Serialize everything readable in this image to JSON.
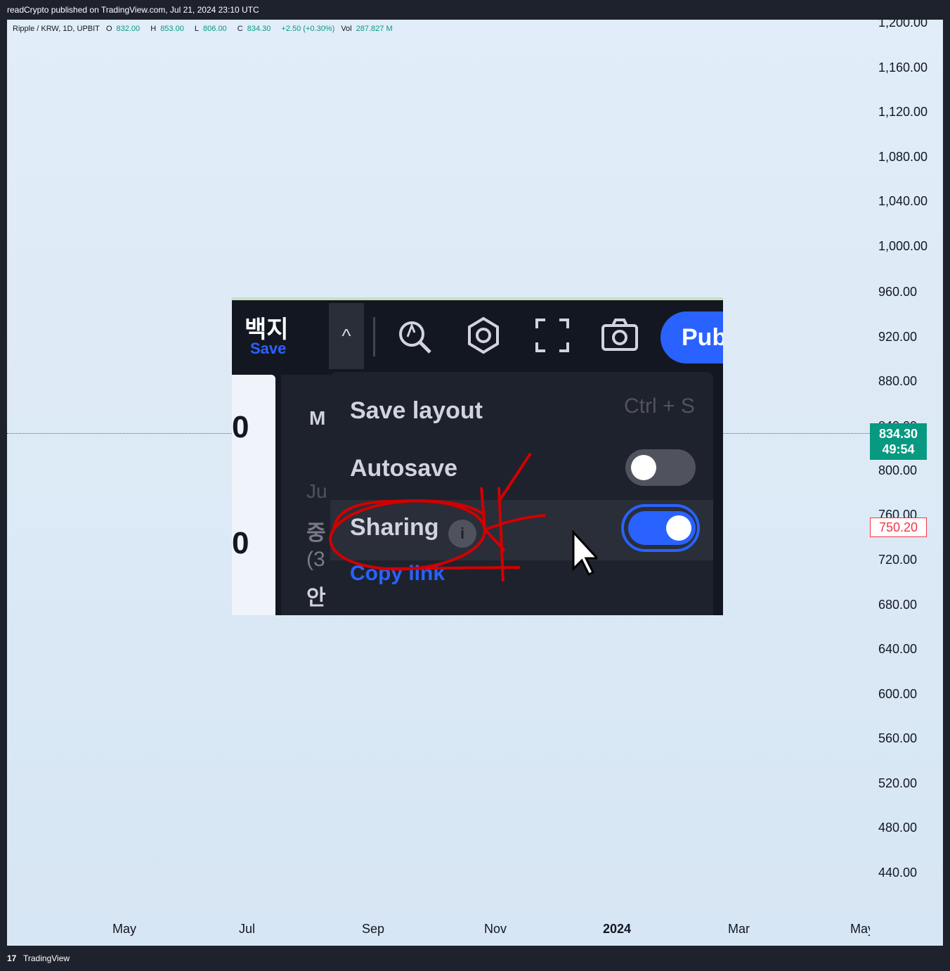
{
  "header": {
    "published": "readCrypto published on TradingView.com, Jul 21, 2024 23:10 UTC"
  },
  "legend": {
    "symbol": "Ripple / KRW, 1D, UPBIT",
    "open_label": "O",
    "open": "832.00",
    "high_label": "H",
    "high": "853.00",
    "low_label": "L",
    "low": "806.00",
    "close_label": "C",
    "close": "834.30",
    "change": "+2.50 (+0.30%)",
    "vol_label": "Vol",
    "vol": "287.827 M"
  },
  "yaxis": [
    "1,200.00",
    "1,160.00",
    "1,120.00",
    "1,080.00",
    "1,040.00",
    "1,000.00",
    "960.00",
    "920.00",
    "880.00",
    "840.00",
    "800.00",
    "760.00",
    "720.00",
    "680.00",
    "640.00",
    "600.00",
    "560.00",
    "520.00",
    "480.00",
    "440.00"
  ],
  "price_tag": {
    "price": "834.30",
    "countdown": "49:54"
  },
  "low_tag": {
    "price": "750.20"
  },
  "xaxis": [
    "May",
    "Jul",
    "Sep",
    "Nov",
    "2024",
    "Mar",
    "May"
  ],
  "screenshot": {
    "title_kr": "백지",
    "save_label": "Save",
    "caret": "^",
    "publish_label": "Pub",
    "left_values": [
      "0",
      "0"
    ],
    "mid_labels": [
      "M",
      "Ju",
      "중",
      "(3",
      "안"
    ],
    "menu": {
      "save_layout": "Save layout",
      "shortcut": "Ctrl + S",
      "autosave": "Autosave",
      "autosave_on": false,
      "sharing": "Sharing",
      "sharing_on": true,
      "info": "i",
      "copy_link": "Copy link"
    }
  },
  "footer": {
    "logo": "17",
    "brand": "TradingView"
  },
  "colors": {
    "up": "#089981",
    "down": "#f23645",
    "accent": "#2962ff",
    "annotation": "#d10000"
  }
}
